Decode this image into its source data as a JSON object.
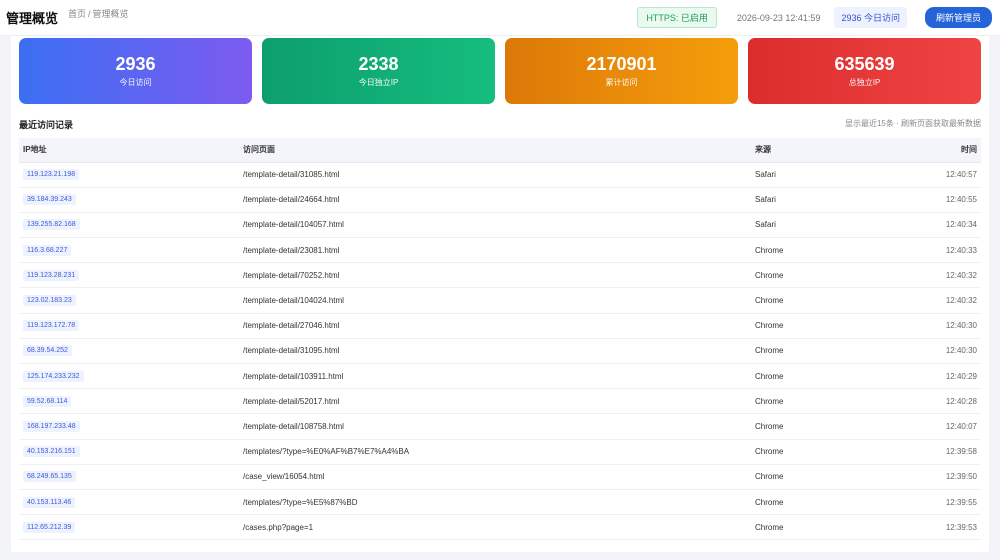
{
  "header": {
    "title": "管理概览",
    "breadcrumb_home": "首页",
    "breadcrumb_sep": "/",
    "breadcrumb_current": "管理概览",
    "https_status": "HTTPS: 已启用",
    "datetime": "2026-09-23 12:41:59",
    "today_visits_pill": "2936 今日访问",
    "refresh_label": "刷新管理员"
  },
  "stats": [
    {
      "value": "2936",
      "label": "今日访问"
    },
    {
      "value": "2338",
      "label": "今日独立IP"
    },
    {
      "value": "2170901",
      "label": "累计访问"
    },
    {
      "value": "635639",
      "label": "总独立IP"
    }
  ],
  "records": {
    "title": "最近访问记录",
    "note": "显示最近15条 · 刷新页面获取最新数据",
    "columns": {
      "ip": "IP地址",
      "page": "访问页面",
      "source": "来源",
      "time": "时间"
    },
    "rows": [
      {
        "ip": "119.123.21.198",
        "page": "/template-detail/31085.html",
        "source": "Safari",
        "time": "12:40:57"
      },
      {
        "ip": "39.184.39.243",
        "page": "/template-detail/24664.html",
        "source": "Safari",
        "time": "12:40:55"
      },
      {
        "ip": "139.255.82.168",
        "page": "/template-detail/104057.html",
        "source": "Safari",
        "time": "12:40:34"
      },
      {
        "ip": "116.3.68.227",
        "page": "/template-detail/23081.html",
        "source": "Chrome",
        "time": "12:40:33"
      },
      {
        "ip": "119.123.28.231",
        "page": "/template-detail/70252.html",
        "source": "Chrome",
        "time": "12:40:32"
      },
      {
        "ip": "123.02.183.23",
        "page": "/template-detail/104024.html",
        "source": "Chrome",
        "time": "12:40:32"
      },
      {
        "ip": "119.123.172.78",
        "page": "/template-detail/27046.html",
        "source": "Chrome",
        "time": "12:40:30"
      },
      {
        "ip": "68.39.54.252",
        "page": "/template-detail/31095.html",
        "source": "Chrome",
        "time": "12:40:30"
      },
      {
        "ip": "125.174.233.232",
        "page": "/template-detail/103911.html",
        "source": "Chrome",
        "time": "12:40:29"
      },
      {
        "ip": "59.52.68.114",
        "page": "/template-detail/52017.html",
        "source": "Chrome",
        "time": "12:40:28"
      },
      {
        "ip": "168.197.233.48",
        "page": "/template-detail/108758.html",
        "source": "Chrome",
        "time": "12:40:07"
      },
      {
        "ip": "40.153.216.151",
        "page": "/templates/?type=%E0%AF%B7%E7%A4%BA",
        "source": "Chrome",
        "time": "12:39:58"
      },
      {
        "ip": "68.249.65.135",
        "page": "/case_view/16054.html",
        "source": "Chrome",
        "time": "12:39:50"
      },
      {
        "ip": "40.153.113.46",
        "page": "/templates/?type=%E5%87%BD",
        "source": "Chrome",
        "time": "12:39:55"
      },
      {
        "ip": "112.65.212.39",
        "page": "/cases.php?page=1",
        "source": "Chrome",
        "time": "12:39:53"
      }
    ]
  }
}
